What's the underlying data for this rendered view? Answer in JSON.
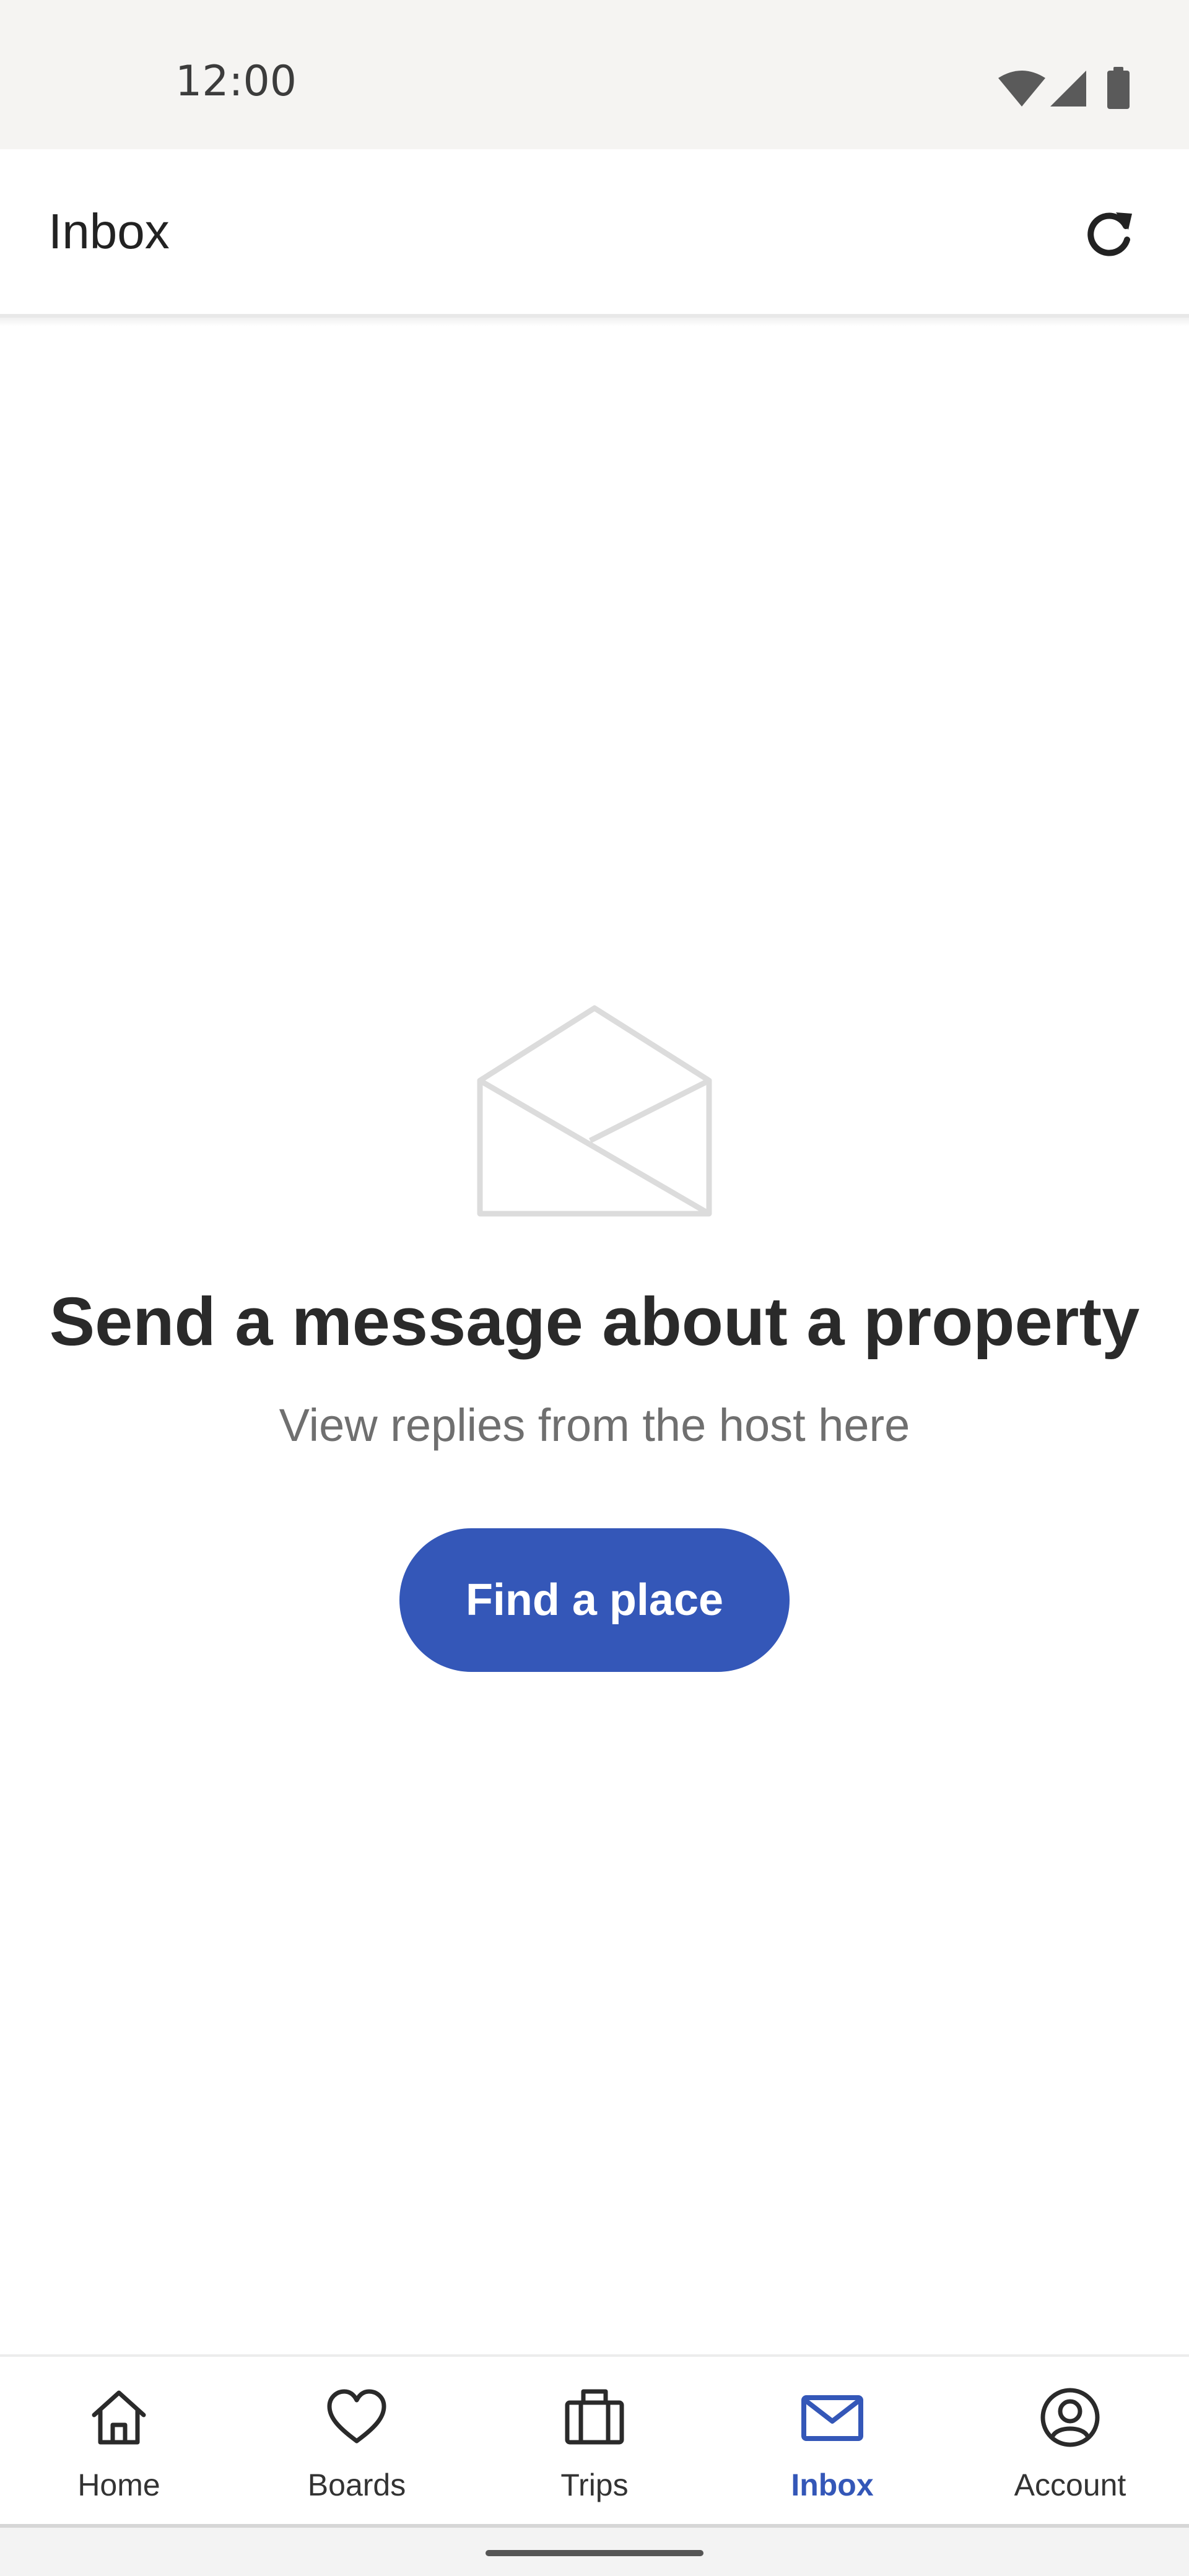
{
  "status_bar": {
    "time": "12:00",
    "icons": [
      "wifi-icon",
      "cellular-signal-icon",
      "battery-icon"
    ]
  },
  "app_bar": {
    "title": "Inbox",
    "refresh_icon": "refresh-icon"
  },
  "empty_state": {
    "icon": "open-envelope-icon",
    "title": "Send a message about a property",
    "subtitle": "View replies from the host here",
    "button_label": "Find a place"
  },
  "bottom_nav": {
    "items": [
      {
        "label": "Home",
        "icon": "home-icon",
        "active": false
      },
      {
        "label": "Boards",
        "icon": "heart-icon",
        "active": false
      },
      {
        "label": "Trips",
        "icon": "suitcase-icon",
        "active": false
      },
      {
        "label": "Inbox",
        "icon": "mail-icon",
        "active": true
      },
      {
        "label": "Account",
        "icon": "account-icon",
        "active": false
      }
    ]
  },
  "colors": {
    "accent": "#3457b8",
    "status_bar_bg": "#f5f4f2",
    "text_primary": "#222222",
    "text_secondary": "#6f6f6f",
    "icon_placeholder": "#dcdcdc"
  }
}
